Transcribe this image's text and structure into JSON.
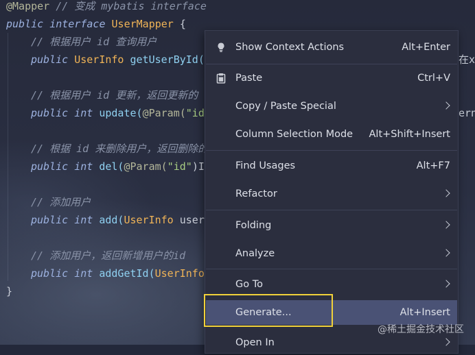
{
  "code": {
    "lines": [
      [
        {
          "t": "@Mapper",
          "c": "ann"
        },
        {
          "t": " // 变成 mybatis interface",
          "c": "cm"
        }
      ],
      [
        {
          "t": "public ",
          "c": "kw"
        },
        {
          "t": "interface ",
          "c": "kw"
        },
        {
          "t": "UserMapper",
          "c": "ty"
        },
        {
          "t": " {",
          "c": "pl"
        }
      ],
      [
        {
          "t": "// 根据用户 id 查询用户",
          "c": "cm"
        }
      ],
      [
        {
          "t": "public ",
          "c": "kw"
        },
        {
          "t": "UserInfo ",
          "c": "ty"
        },
        {
          "t": "getUserById(",
          "c": "fn"
        }
      ],
      [],
      [
        {
          "t": "// 根据用户 id 更新，返回更新的",
          "c": "cm"
        }
      ],
      [
        {
          "t": "public ",
          "c": "kw"
        },
        {
          "t": "int ",
          "c": "kw"
        },
        {
          "t": "update(",
          "c": "fn"
        },
        {
          "t": "@Param(",
          "c": "ann"
        },
        {
          "t": "\"id",
          "c": "st"
        }
      ],
      [],
      [
        {
          "t": "// 根据 id 来删除用户，返回删除的",
          "c": "cm"
        }
      ],
      [
        {
          "t": "public ",
          "c": "kw"
        },
        {
          "t": "int ",
          "c": "kw"
        },
        {
          "t": "del(",
          "c": "fn"
        },
        {
          "t": "@Param(",
          "c": "ann"
        },
        {
          "t": "\"id\"",
          "c": "st"
        },
        {
          "t": ")I",
          "c": "pl"
        }
      ],
      [],
      [
        {
          "t": "// 添加用户",
          "c": "cm"
        }
      ],
      [
        {
          "t": "public ",
          "c": "kw"
        },
        {
          "t": "int ",
          "c": "kw"
        },
        {
          "t": "add(",
          "c": "fn"
        },
        {
          "t": "UserInfo ",
          "c": "ty"
        },
        {
          "t": "user",
          "c": "pl"
        }
      ],
      [],
      [
        {
          "t": "// 添加用户，返回新增用户的id",
          "c": "cm"
        }
      ],
      [
        {
          "t": "public ",
          "c": "kw"
        },
        {
          "t": "int ",
          "c": "kw"
        },
        {
          "t": "addGetId(",
          "c": "fn"
        },
        {
          "t": "UserInfo",
          "c": "ty"
        }
      ],
      [
        {
          "t": "}",
          "c": "pl"
        }
      ]
    ],
    "clipped_right": [
      {
        "text": "在x",
        "row": 3
      },
      {
        "text": "ern",
        "row": 6
      }
    ]
  },
  "menu": {
    "items": [
      {
        "label": "Show Context Actions",
        "shortcut": "Alt+Enter",
        "icon": "lightbulb-icon"
      },
      {
        "label": "Paste",
        "shortcut": "Ctrl+V",
        "icon": "clipboard-icon"
      },
      {
        "label": "Copy / Paste Special",
        "submenu": true
      },
      {
        "label": "Column Selection Mode",
        "shortcut": "Alt+Shift+Insert"
      },
      {
        "label": "Find Usages",
        "shortcut": "Alt+F7"
      },
      {
        "label": "Refactor",
        "submenu": true
      },
      {
        "label": "Folding",
        "submenu": true
      },
      {
        "label": "Analyze",
        "submenu": true
      },
      {
        "label": "Go To",
        "submenu": true
      },
      {
        "label": "Generate...",
        "shortcut": "Alt+Insert",
        "selected": true
      },
      {
        "label": "Open In",
        "submenu": true
      }
    ]
  },
  "watermark": "@稀土掘金技术社区",
  "colors": {
    "highlight_box": "#f2d23a",
    "selected_item": "#4a5275",
    "menu_bg": "#2b2e3e"
  }
}
